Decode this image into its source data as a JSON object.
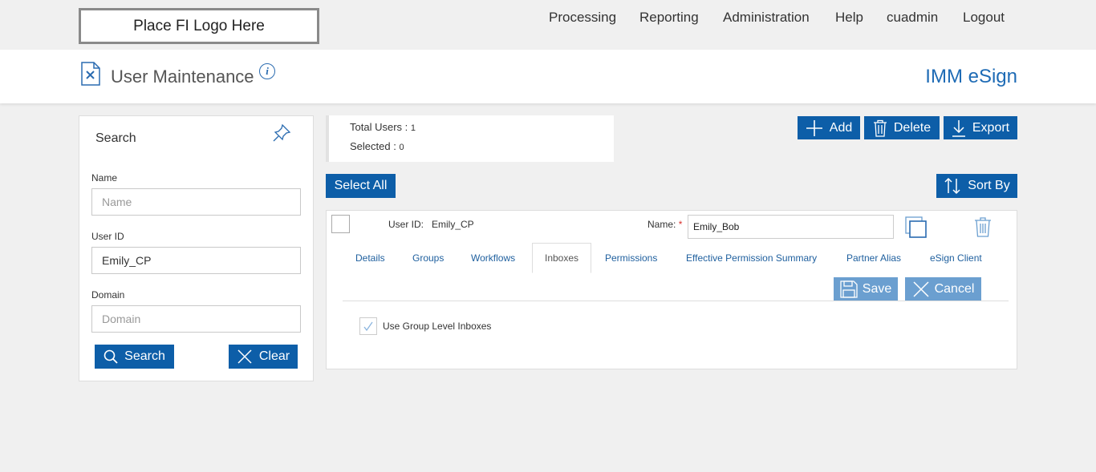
{
  "header": {
    "logo_text": "Place FI Logo Here",
    "nav": [
      "Processing",
      "Reporting",
      "Administration",
      "Help",
      "cuadmin",
      "Logout"
    ]
  },
  "page": {
    "title": "User Maintenance",
    "info_glyph": "i",
    "brand": "IMM eSign"
  },
  "search": {
    "title": "Search",
    "name_label": "Name",
    "name_placeholder": "Name",
    "name_value": "",
    "userid_label": "User ID",
    "userid_value": "Emily_CP",
    "domain_label": "Domain",
    "domain_placeholder": "Domain",
    "domain_value": "",
    "search_button": "Search",
    "clear_button": "Clear"
  },
  "stats": {
    "total_label": "Total Users :",
    "total_value": "1",
    "selected_label": "Selected :",
    "selected_value": "0"
  },
  "toolbar": {
    "add": "Add",
    "delete": "Delete",
    "export": "Export",
    "select_all": "Select All",
    "sort_by": "Sort By"
  },
  "user_card": {
    "userid_label": "User ID:",
    "userid_value": "Emily_CP",
    "name_label": "Name:",
    "required_mark": "*",
    "name_value": "Emily_Bob",
    "tabs": [
      "Details",
      "Groups",
      "Workflows",
      "Inboxes",
      "Permissions",
      "Effective Permission Summary",
      "Partner Alias",
      "eSign Client"
    ],
    "active_tab": "Inboxes",
    "save": "Save",
    "cancel": "Cancel",
    "checkbox_label": "Use Group Level Inboxes",
    "checkbox_checked": true
  },
  "colors": {
    "primary": "#0d5ea8",
    "primary_light": "#6b9fd0",
    "brand_text": "#1e6bb5",
    "required": "#d9302c"
  }
}
